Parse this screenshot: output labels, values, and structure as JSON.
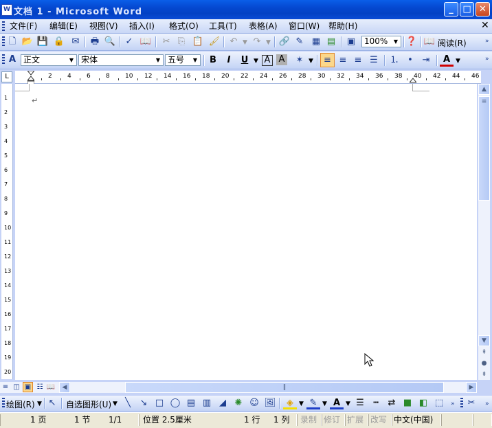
{
  "window": {
    "title": "文档 1 - Microsoft Word"
  },
  "menu": [
    "文件(F)",
    "编辑(E)",
    "视图(V)",
    "插入(I)",
    "格式(O)",
    "工具(T)",
    "表格(A)",
    "窗口(W)",
    "帮助(H)"
  ],
  "standard_toolbar": {
    "zoom": "100%",
    "read_label": "阅读(R)"
  },
  "format_toolbar": {
    "style": "正文",
    "font": "宋体",
    "size": "五号",
    "bold": "B",
    "italic": "I",
    "underline": "U",
    "border_char": "A",
    "shade_char": "A",
    "font_color_char": "A"
  },
  "ruler": {
    "labels": [
      "2",
      "4",
      "6",
      "8",
      "10",
      "12",
      "14",
      "16",
      "18",
      "20",
      "22",
      "24",
      "26",
      "28",
      "30",
      "32",
      "34",
      "36",
      "38",
      "40",
      "42",
      "44",
      "46"
    ],
    "vlabels": [
      "1",
      "2",
      "3",
      "4",
      "5",
      "6",
      "7",
      "8",
      "9",
      "10",
      "11",
      "12",
      "13",
      "14",
      "15",
      "16",
      "17",
      "18",
      "19",
      "20"
    ]
  },
  "document": {
    "paragraph_mark": "↵"
  },
  "drawing_toolbar": {
    "draw_label": "绘图(R)",
    "autoshape_label": "自选图形(U)"
  },
  "statusbar": {
    "page": "1 页",
    "section": "1 节",
    "pages": "1/1",
    "position": "位置 2.5厘米",
    "line": "1 行",
    "column": "1 列",
    "rec": "录制",
    "trk": "修订",
    "ext": "扩展",
    "ovr": "改写",
    "language": "中文(中国)"
  },
  "colors": {
    "titlebar": "#0548d0",
    "toolbar": "#c6d3f7",
    "close_button": "#c9461f"
  }
}
